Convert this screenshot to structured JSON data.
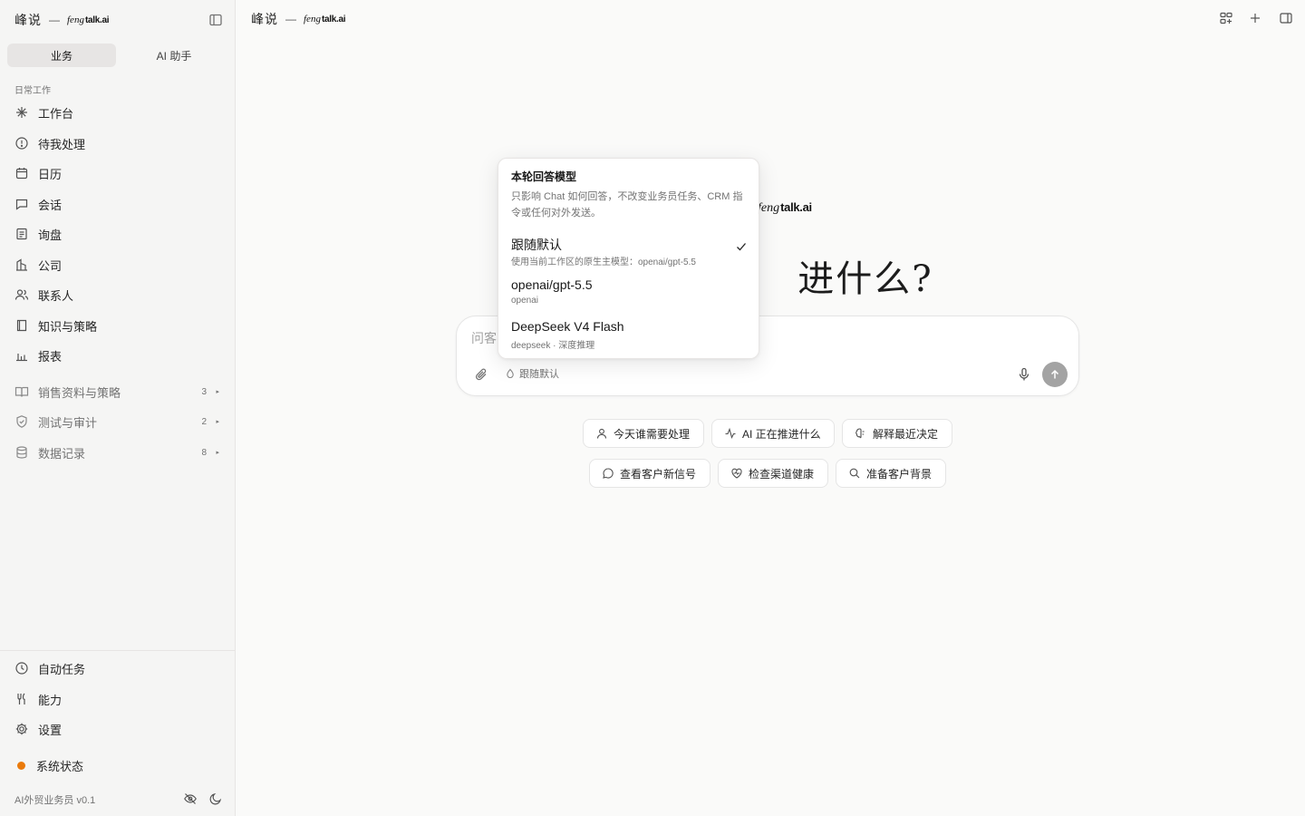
{
  "app": {
    "brand_zh": "峰说",
    "brand_dash": "—",
    "logo_feng": "feng",
    "logo_talk": "talk.ai"
  },
  "sidebar": {
    "tabs": [
      {
        "label": "业务",
        "active": true
      },
      {
        "label": "AI 助手",
        "active": false
      }
    ],
    "section_label": "日常工作",
    "items": [
      {
        "label": "工作台",
        "icon": "sparkle-icon"
      },
      {
        "label": "待我处理",
        "icon": "alert-circle-icon"
      },
      {
        "label": "日历",
        "icon": "calendar-icon"
      },
      {
        "label": "会话",
        "icon": "message-icon"
      },
      {
        "label": "询盘",
        "icon": "inquiry-icon"
      },
      {
        "label": "公司",
        "icon": "building-icon"
      },
      {
        "label": "联系人",
        "icon": "contacts-icon"
      },
      {
        "label": "知识与策略",
        "icon": "book-icon"
      },
      {
        "label": "报表",
        "icon": "bar-chart-icon"
      }
    ],
    "groups": [
      {
        "label": "销售资料与策略",
        "count": "3",
        "icon": "open-book-icon"
      },
      {
        "label": "测试与审计",
        "count": "2",
        "icon": "shield-check-icon"
      },
      {
        "label": "数据记录",
        "count": "8",
        "icon": "database-icon"
      }
    ],
    "bottom_items": [
      {
        "label": "自动任务",
        "icon": "clock-icon"
      },
      {
        "label": "能力",
        "icon": "tools-icon"
      },
      {
        "label": "设置",
        "icon": "gear-icon"
      }
    ],
    "status_label": "系统状态",
    "status_color": "#ea7a0b",
    "version": "AI外贸业务员 v0.1"
  },
  "main": {
    "title_visible": "进什么?",
    "composer": {
      "placeholder": "问客户、询盘、公司、任务，或让 AI 推进下一步……",
      "visible_placeholder": "问客",
      "model_label": "跟随默认"
    },
    "chips": [
      {
        "label": "今天谁需要处理",
        "icon": "user-icon"
      },
      {
        "label": "AI 正在推进什么",
        "icon": "activity-icon"
      },
      {
        "label": "解释最近决定",
        "icon": "brain-icon"
      },
      {
        "label": "查看客户新信号",
        "icon": "chat-bubble-icon"
      },
      {
        "label": "检查渠道健康",
        "icon": "heart-pulse-icon"
      },
      {
        "label": "准备客户背景",
        "icon": "search-icon"
      }
    ]
  },
  "model_menu": {
    "title": "本轮回答模型",
    "description": "只影响 Chat 如何回答，不改变业务员任务、CRM 指令或任何对外发送。",
    "options": [
      {
        "label": "跟随默认",
        "sub": "使用当前工作区的原生主模型：openai/gpt-5.5",
        "selected": true
      },
      {
        "label": "openai/gpt-5.5",
        "sub": "openai",
        "selected": false
      },
      {
        "label": "DeepSeek V4 Flash",
        "sub": "deepseek · 深度推理",
        "selected": false
      }
    ]
  }
}
